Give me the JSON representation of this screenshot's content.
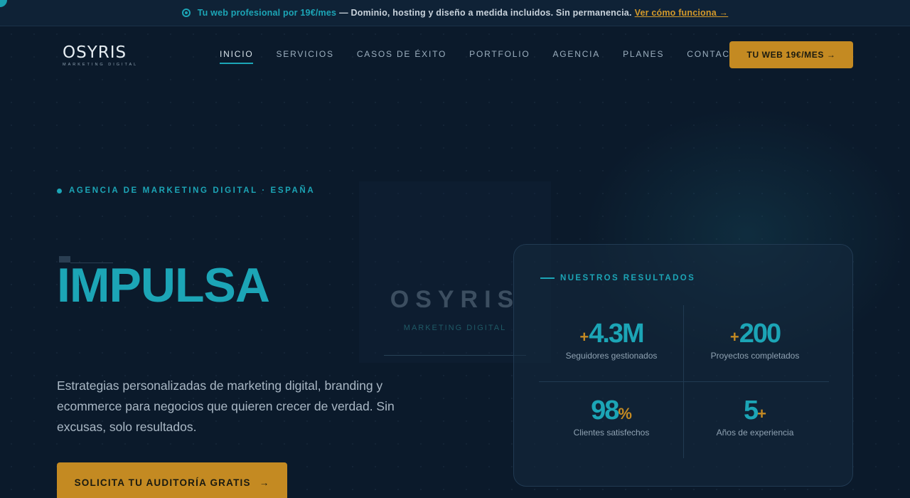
{
  "promo": {
    "highlight": "Tu web profesional por 19€/mes",
    "text": "— Dominio, hosting y diseño a medida incluidos. Sin permanencia.",
    "link": "Ver cómo funciona →",
    "icon": "target-icon"
  },
  "logo": {
    "word": "OSYRIS",
    "sub": "MARKETING DIGITAL"
  },
  "nav": {
    "items": [
      {
        "label": "INICIO",
        "active": true
      },
      {
        "label": "SERVICIOS"
      },
      {
        "label": "CASOS DE ÉXITO"
      },
      {
        "label": "PORTFOLIO"
      },
      {
        "label": "AGENCIA"
      },
      {
        "label": "PLANES"
      },
      {
        "label": "CONTACTO"
      }
    ],
    "cta": "TU WEB 19€/MES →"
  },
  "hero": {
    "eyebrow": "AGENCIA DE MARKETING DIGITAL · ESPAÑA",
    "title": "IMPULSA",
    "description": "Estrategias personalizadas de marketing digital, branding y ecommerce para negocios que quieren crecer de verdad. Sin excusas, solo resultados.",
    "cta": "SOLICITA TU AUDITORÍA GRATIS",
    "cta_arrow": "→"
  },
  "brand": {
    "word": "OSYRIS",
    "sub": "MARKETING DIGITAL"
  },
  "results": {
    "heading": "NUESTROS RESULTADOS",
    "stats": [
      {
        "prefix": "+",
        "value": "4.3M",
        "suffix": "",
        "label": "Seguidores gestionados"
      },
      {
        "prefix": "+",
        "value": "200",
        "suffix": "",
        "label": "Proyectos completados"
      },
      {
        "prefix": "",
        "value": "98",
        "suffix": "%",
        "label": "Clientes satisfechos"
      },
      {
        "prefix": "",
        "value": "5",
        "suffix": "+",
        "label": "Años de experiencia"
      }
    ]
  },
  "colors": {
    "accent": "#1ca5b6",
    "gold": "#c48a22",
    "background": "#0b1a2b"
  }
}
